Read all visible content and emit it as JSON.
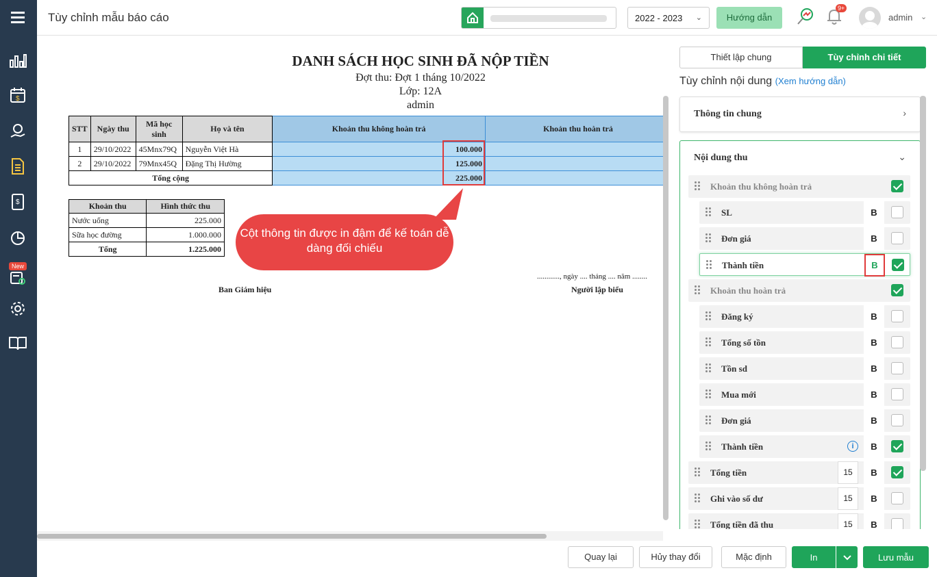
{
  "header": {
    "title": "Tùy chỉnh mẫu báo cáo",
    "year": "2022 - 2023",
    "guide_label": "Hướng dẫn",
    "notif_count": "9+",
    "user": "admin"
  },
  "sidebar": {
    "new_badge": "New",
    "icons": [
      "menu-icon",
      "bar-chart-icon",
      "calendar-dollar-icon",
      "money-hand-icon",
      "document-icon",
      "ledger-icon",
      "pie-chart-icon",
      "checklist-icon",
      "settings-icon",
      "book-icon"
    ]
  },
  "doc": {
    "title": "DANH SÁCH HỌC SINH ĐÃ NỘP TIỀN",
    "period": "Đợt thu: Đợt 1 tháng 10/2022",
    "class": "Lớp: 12A",
    "creator": "admin",
    "table": {
      "headers": [
        "STT",
        "Ngày thu",
        "Mã học sinh",
        "Họ và tên",
        "Khoản thu không hoàn trả",
        "Khoản thu hoàn trả"
      ],
      "rows": [
        {
          "stt": "1",
          "date": "29/10/2022",
          "code": "45Mnx79Q",
          "name": "Nguyễn Việt Hà",
          "amount": "100.000"
        },
        {
          "stt": "2",
          "date": "29/10/2022",
          "code": "79Mnx45Q",
          "name": "Đặng Thị Hường",
          "amount": "125.000"
        }
      ],
      "total_label": "Tổng cộng",
      "total": "225.000"
    },
    "sub_table": {
      "headers": [
        "Khoản thu",
        "Hình thức thu"
      ],
      "rows": [
        {
          "item": "Nước uống",
          "value": "225.000"
        },
        {
          "item": "Sữa học đường",
          "value": "1.000.000"
        }
      ],
      "total_label": "Tổng",
      "total": "1.225.000"
    },
    "callout": "Cột thông tin được in đậm để kế toán dễ dàng đối chiếu",
    "date_line": "............, ngày .... tháng .... năm ........",
    "sig_left": "Ban Giám hiệu",
    "sig_right": "Người lập biểu"
  },
  "panel": {
    "tab_general": "Thiết lập chung",
    "tab_detail": "Tùy chỉnh chi tiết",
    "section_title": "Tùy chỉnh nội dung",
    "section_link": "(Xem hướng dẫn)",
    "acc_general": "Thông tin chung",
    "acc_content": "Nội dung thu",
    "bold_label": "B",
    "rows": [
      {
        "label": "Khoản thu không hoàn trả",
        "group": true,
        "checked": true
      },
      {
        "label": "SL",
        "checked": false
      },
      {
        "label": "Đơn giá",
        "checked": false
      },
      {
        "label": "Thành tiền",
        "checked": true,
        "selected": true
      },
      {
        "label": "Khoản thu hoàn trả",
        "group": true,
        "checked": true
      },
      {
        "label": "Đăng ký",
        "checked": false
      },
      {
        "label": "Tổng số tồn",
        "checked": false
      },
      {
        "label": "Tồn sd",
        "checked": false
      },
      {
        "label": "Mua mới",
        "checked": false
      },
      {
        "label": "Đơn giá",
        "checked": false
      },
      {
        "label": "Thành tiền",
        "checked": true,
        "info": "i"
      },
      {
        "label": "Tổng tiền",
        "checked": true,
        "num": "15"
      },
      {
        "label": "Ghi vào số dư",
        "checked": false,
        "num": "15"
      },
      {
        "label": "Tổng tiền đã thu",
        "checked": false,
        "num": "15"
      }
    ]
  },
  "footer": {
    "back": "Quay lại",
    "cancel": "Hủy thay đổi",
    "default": "Mặc định",
    "print": "In",
    "save": "Lưu mẫu"
  },
  "colors": {
    "accent": "#1fa55a",
    "sidebar": "#283a4e",
    "highlight": "#e03a3a"
  }
}
